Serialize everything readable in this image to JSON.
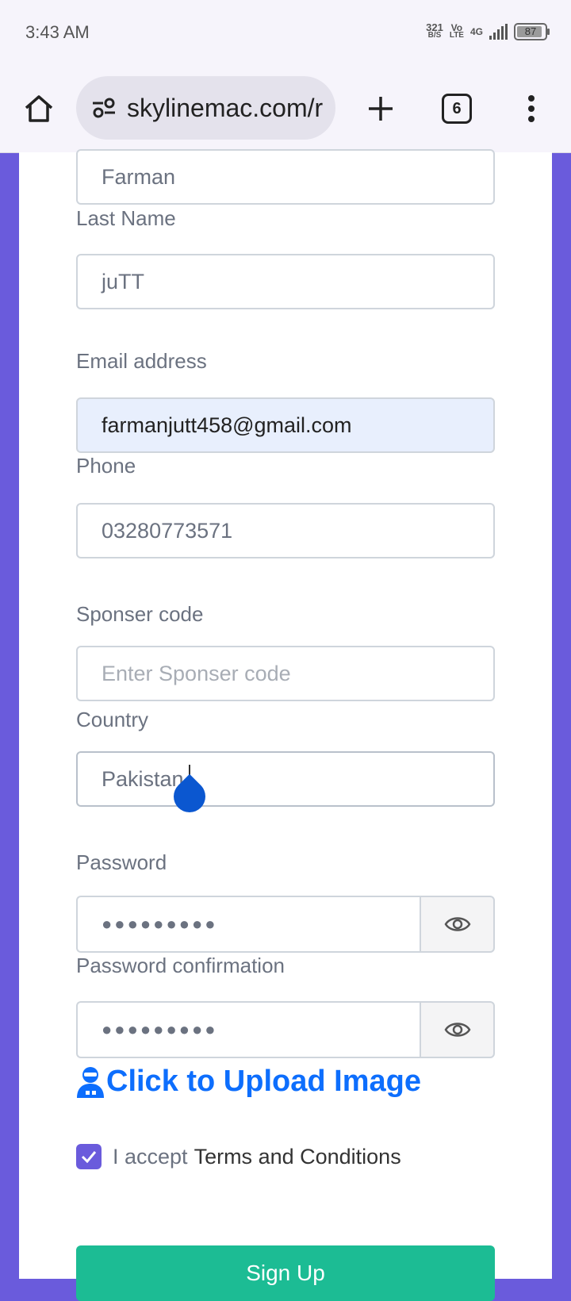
{
  "status_bar": {
    "time": "3:43 AM",
    "net_speed_value": "321",
    "net_speed_unit": "B/S",
    "volte_top": "Vo",
    "volte_bottom": "LTE",
    "network": "4G",
    "battery": "87"
  },
  "browser": {
    "url": "skylinemac.com/r",
    "tab_count": "6",
    "icons": [
      "home-icon",
      "site-settings-icon",
      "new-tab-icon",
      "tabs-icon",
      "more-menu-icon"
    ]
  },
  "form": {
    "first_name": {
      "value": "Farman"
    },
    "last_name": {
      "label": "Last Name",
      "value": "juTT"
    },
    "email": {
      "label": "Email address",
      "value": "farmanjutt458@gmail.com"
    },
    "phone": {
      "label": "Phone",
      "value": "03280773571"
    },
    "sponser": {
      "label": "Sponser code",
      "placeholder": "Enter Sponser code"
    },
    "country": {
      "label": "Country",
      "value": "Pakistan"
    },
    "password": {
      "label": "Password",
      "value": "●●●●●●●●●"
    },
    "password_confirmation": {
      "label": "Password confirmation",
      "value": "●●●●●●●●●"
    },
    "upload_label": "Click to Upload Image",
    "terms_prefix": "I accept",
    "terms_link": "Terms and Conditions",
    "terms_checked": true,
    "submit_label": "Sign Up"
  },
  "colors": {
    "page_background": "#6a5bdc",
    "upload_link": "#0d6efd",
    "submit_button": "#1cbc94",
    "autofill_background": "#e8effd",
    "cursor_handle": "#0b57d0"
  }
}
